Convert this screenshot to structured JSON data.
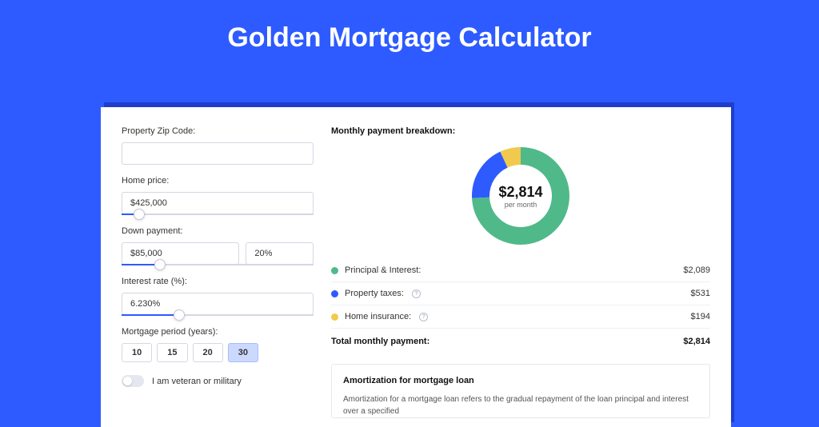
{
  "hero": {
    "title": "Golden Mortgage Calculator"
  },
  "form": {
    "zip": {
      "label": "Property Zip Code:",
      "value": ""
    },
    "price": {
      "label": "Home price:",
      "value": "$425,000",
      "slider_pct": 9
    },
    "down": {
      "label": "Down payment:",
      "amount": "$85,000",
      "pct": "20%",
      "slider_pct": 20
    },
    "rate": {
      "label": "Interest rate (%):",
      "value": "6.230%",
      "slider_pct": 30
    },
    "period": {
      "label": "Mortgage period (years):",
      "options": [
        "10",
        "15",
        "20",
        "30"
      ],
      "selected": "30"
    },
    "veteran": {
      "label": "I am veteran or military",
      "on": false
    }
  },
  "breakdown": {
    "title": "Monthly payment breakdown:",
    "donut": {
      "amount": "$2,814",
      "sub": "per month"
    },
    "items": [
      {
        "label": "Principal & Interest:",
        "value": "$2,089",
        "color": "#4fb98a",
        "info": false
      },
      {
        "label": "Property taxes:",
        "value": "$531",
        "color": "#2d5bff",
        "info": true
      },
      {
        "label": "Home insurance:",
        "value": "$194",
        "color": "#f1c94e",
        "info": true
      }
    ],
    "total": {
      "label": "Total monthly payment:",
      "value": "$2,814"
    }
  },
  "amort": {
    "title": "Amortization for mortgage loan",
    "text": "Amortization for a mortgage loan refers to the gradual repayment of the loan principal and interest over a specified"
  },
  "chart_data": {
    "type": "pie",
    "title": "Monthly payment breakdown",
    "categories": [
      "Principal & Interest",
      "Property taxes",
      "Home insurance"
    ],
    "values": [
      2089,
      531,
      194
    ],
    "colors": [
      "#4fb98a",
      "#2d5bff",
      "#f1c94e"
    ],
    "total": 2814,
    "center_label": "$2,814 per month"
  }
}
